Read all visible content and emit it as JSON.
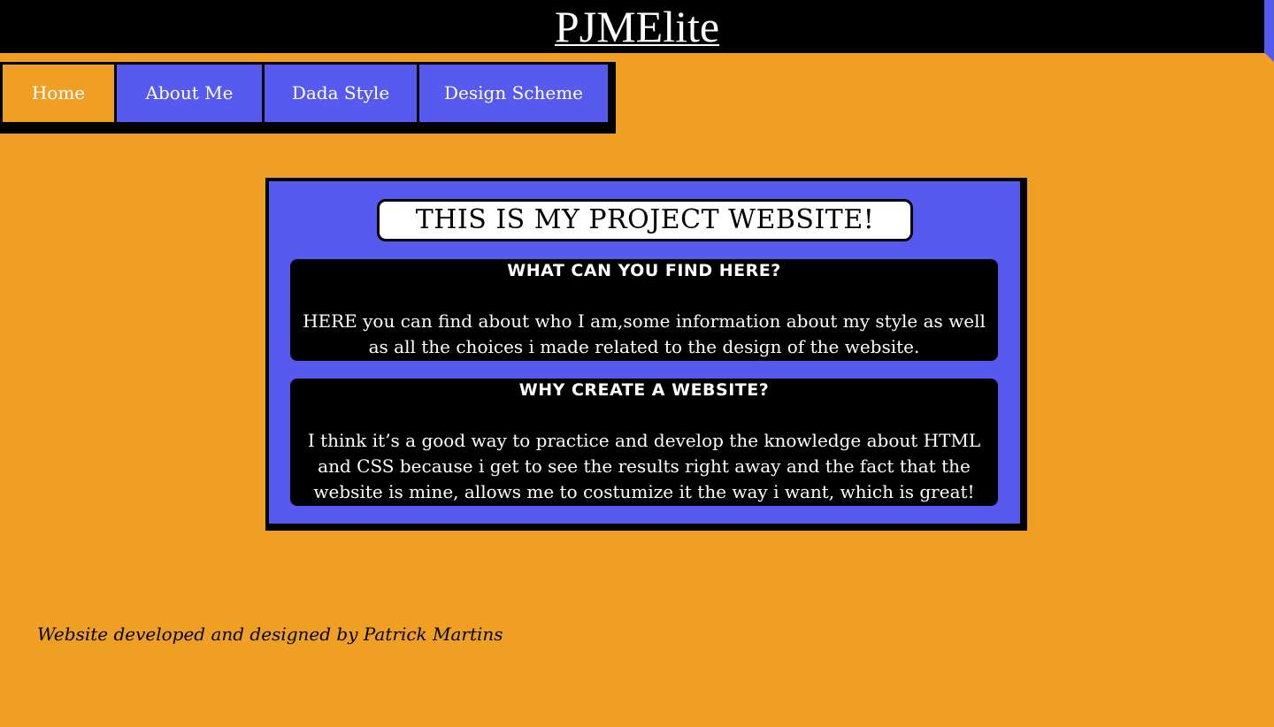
{
  "header": {
    "title": "PJMElite"
  },
  "nav": {
    "items": [
      {
        "label": "Home",
        "active": true
      },
      {
        "label": "About Me",
        "active": false
      },
      {
        "label": "Dada Style",
        "active": false
      },
      {
        "label": "Design Scheme",
        "active": false
      }
    ]
  },
  "main": {
    "heading": "THIS IS MY PROJECT WEBSITE!",
    "sections": [
      {
        "title": "WHAT CAN YOU FIND HERE?",
        "text": "HERE you can find about who I am,some information about my style as well as all the choices i made related to the design of the website."
      },
      {
        "title": "WHY CREATE A WEBSITE?",
        "text": "I think it’s a good way to practice and develop the knowledge about HTML and CSS because i get to see the results right away and the fact that the website is mine, allows me to costumize it the way i want, which is great!"
      }
    ]
  },
  "footer": {
    "credit": "Website developed and designed by Patrick Martins"
  },
  "colors": {
    "background": "#EE9F24",
    "accent": "#565AEE",
    "dark": "#000000",
    "light": "#FFFFFF"
  }
}
